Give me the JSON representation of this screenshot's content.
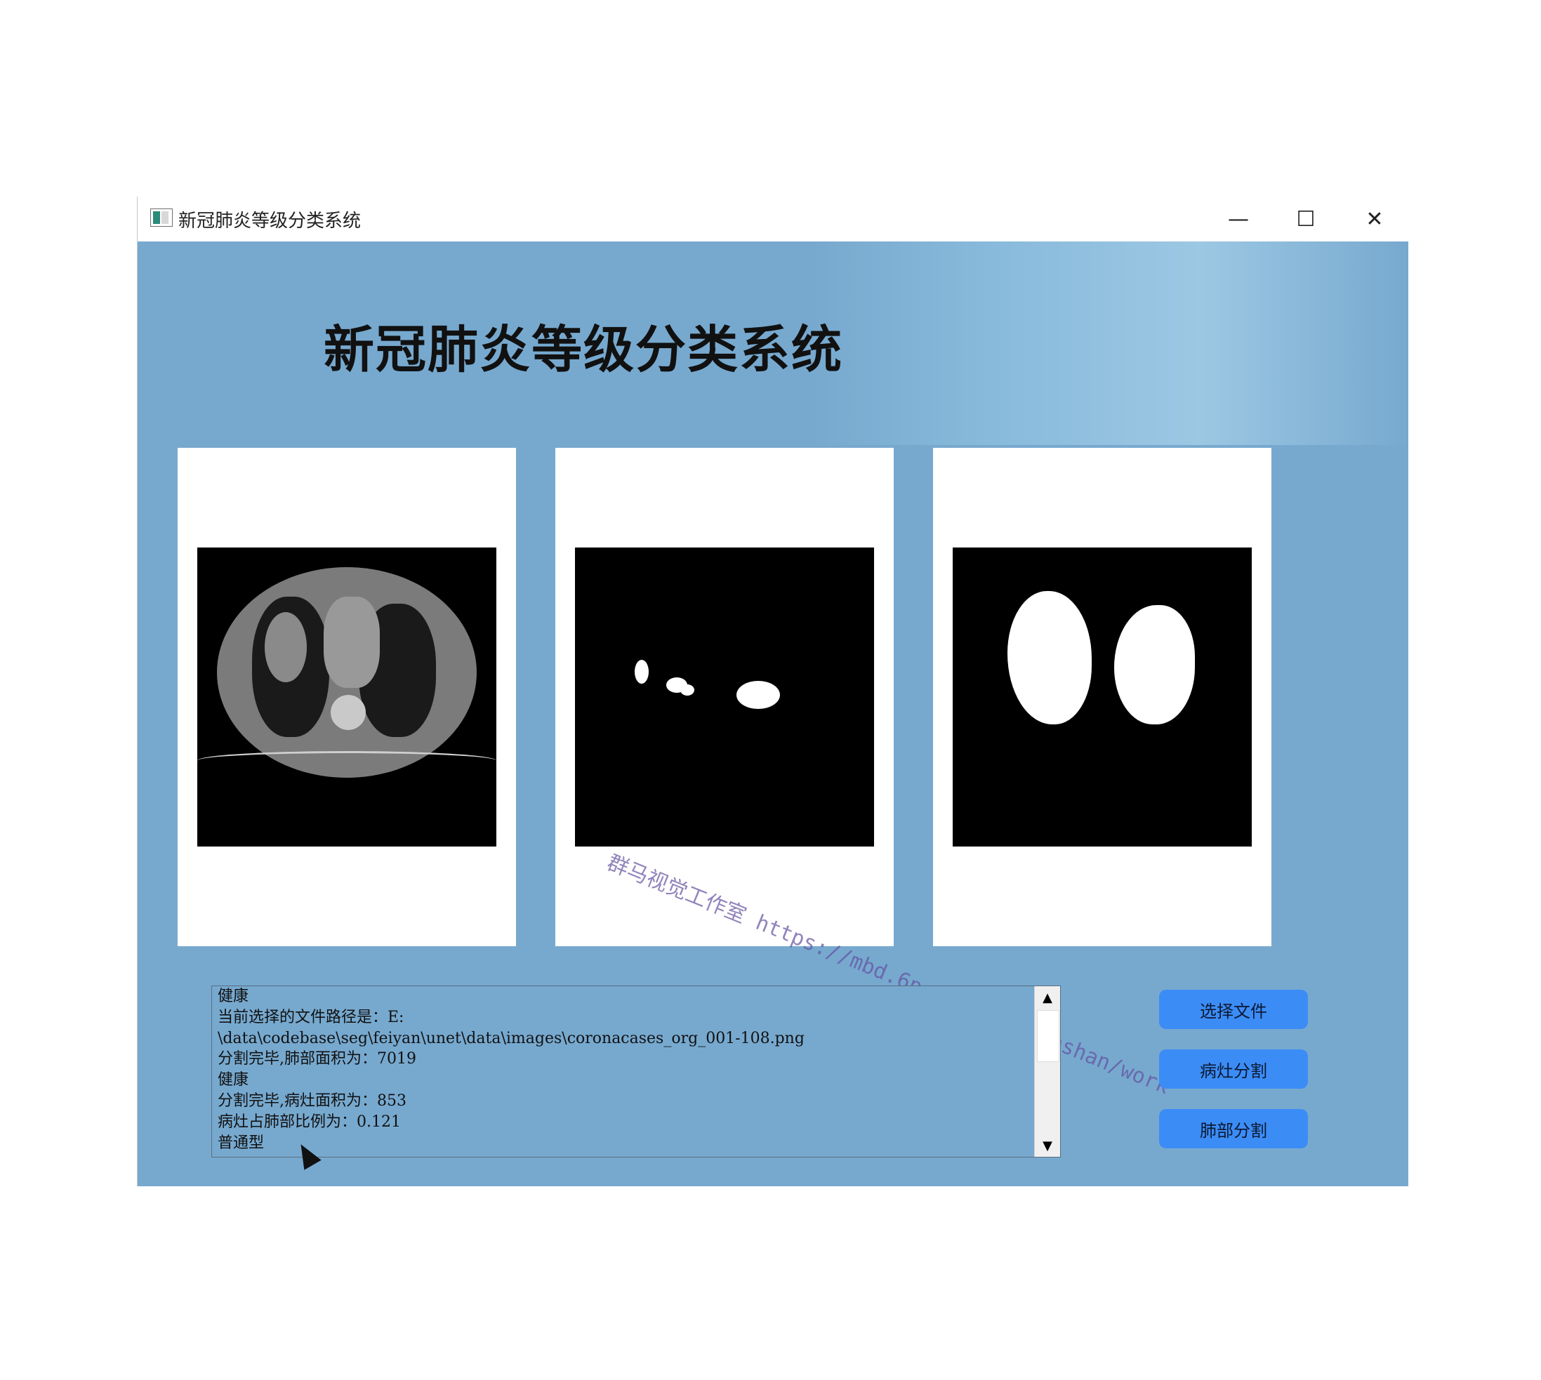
{
  "window": {
    "title": "新冠肺炎等级分类系统",
    "controls": {
      "minimize": "—",
      "maximize": "☐",
      "close": "✕"
    }
  },
  "banner": {
    "title": "新冠肺炎等级分类系统"
  },
  "panels": [
    {
      "label": "ct-scan"
    },
    {
      "label": "lesion-mask"
    },
    {
      "label": "lung-mask"
    }
  ],
  "log": {
    "lines": [
      "健康",
      "当前选择的文件路径是：E:",
      "\\data\\codebase\\seg\\feiyan\\unet\\data\\images\\coronacases_org_001-108.png",
      "分割完毕,肺部面积为：7019",
      "健康",
      "分割完毕,病灶面积为：853",
      "病灶占肺部比例为：0.121",
      "普通型"
    ]
  },
  "buttons": {
    "select_file": "选择文件",
    "lesion_segment": "病灶分割",
    "lung_segment": "肺部分割"
  },
  "watermark": "群马视觉工作室 https://mbd.6pen.art/o/qunshan/work",
  "colors": {
    "client_bg": "#77a9cf",
    "button": "#3c8cf6"
  }
}
